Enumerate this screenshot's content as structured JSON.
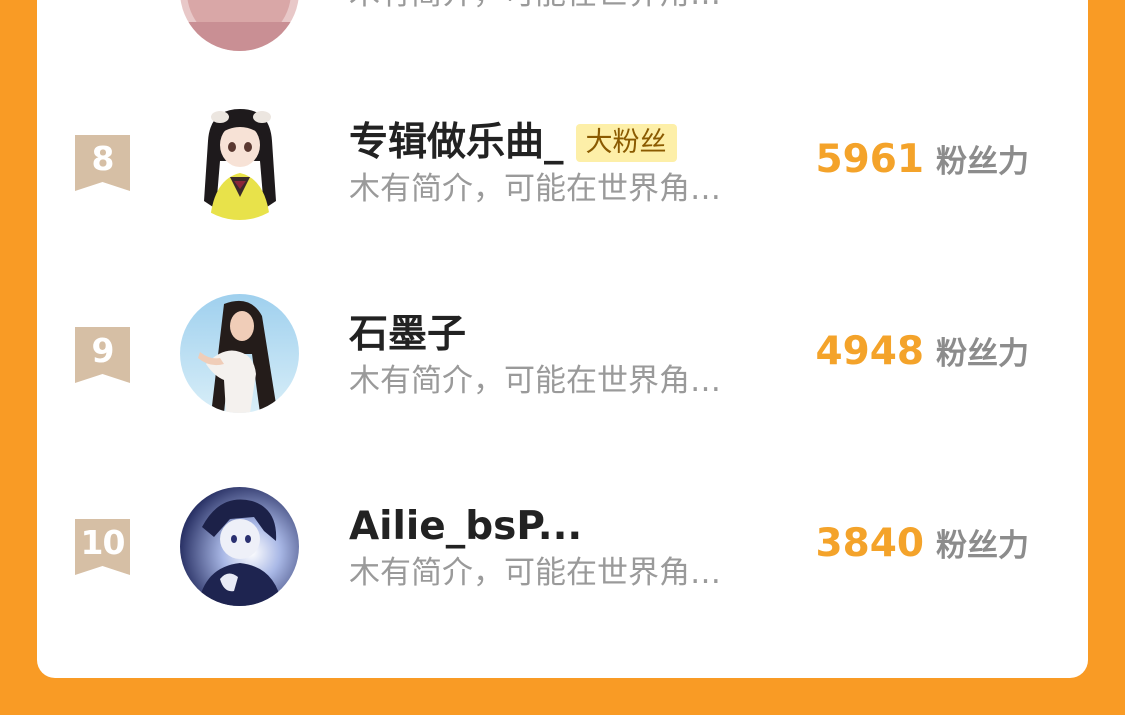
{
  "colors": {
    "page_background": "#f99b25",
    "card_background": "#ffffff",
    "rank_flag": "#d6bfa5",
    "fan_power_value": "#f4a32a",
    "badge_background": "#fdefa8"
  },
  "top_partial_row": {
    "bio": "木有简介，可能在世界角…"
  },
  "rows": [
    {
      "rank": "8",
      "name": "专辑做乐曲_",
      "badge": "大粉丝",
      "bio": "木有简介，可能在世界角…",
      "fan_power": "5961",
      "fan_power_unit": "粉丝力",
      "avatar_icon": "anime-girl-avatar-icon"
    },
    {
      "rank": "9",
      "name": "石墨子",
      "bio": "木有简介，可能在世界角…",
      "fan_power": "4948",
      "fan_power_unit": "粉丝力",
      "avatar_icon": "photo-girl-avatar-icon"
    },
    {
      "rank": "10",
      "name": "Ailie_bsP...",
      "bio": "木有简介，可能在世界角…",
      "fan_power": "3840",
      "fan_power_unit": "粉丝力",
      "avatar_icon": "anime-boy-avatar-icon"
    }
  ]
}
